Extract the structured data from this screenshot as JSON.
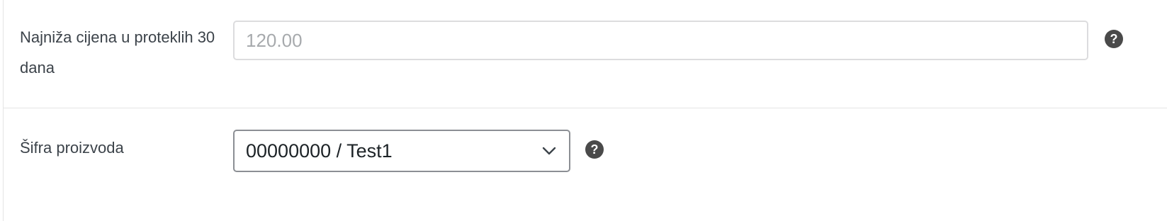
{
  "price_field": {
    "label": "Najniža cijena u proteklih 30 dana",
    "placeholder": "120.00",
    "help_icon": "question-circle-icon"
  },
  "sku_field": {
    "label": "Šifra proizvoda",
    "selected_value": "00000000 / Test1",
    "dropdown_icon": "chevron-down-icon",
    "help_icon": "question-circle-icon"
  },
  "colors": {
    "help_icon_bg": "#4a4a4a",
    "input_border": "#dcdcde",
    "select_border": "#8c8f94",
    "placeholder": "#a7aaad"
  }
}
